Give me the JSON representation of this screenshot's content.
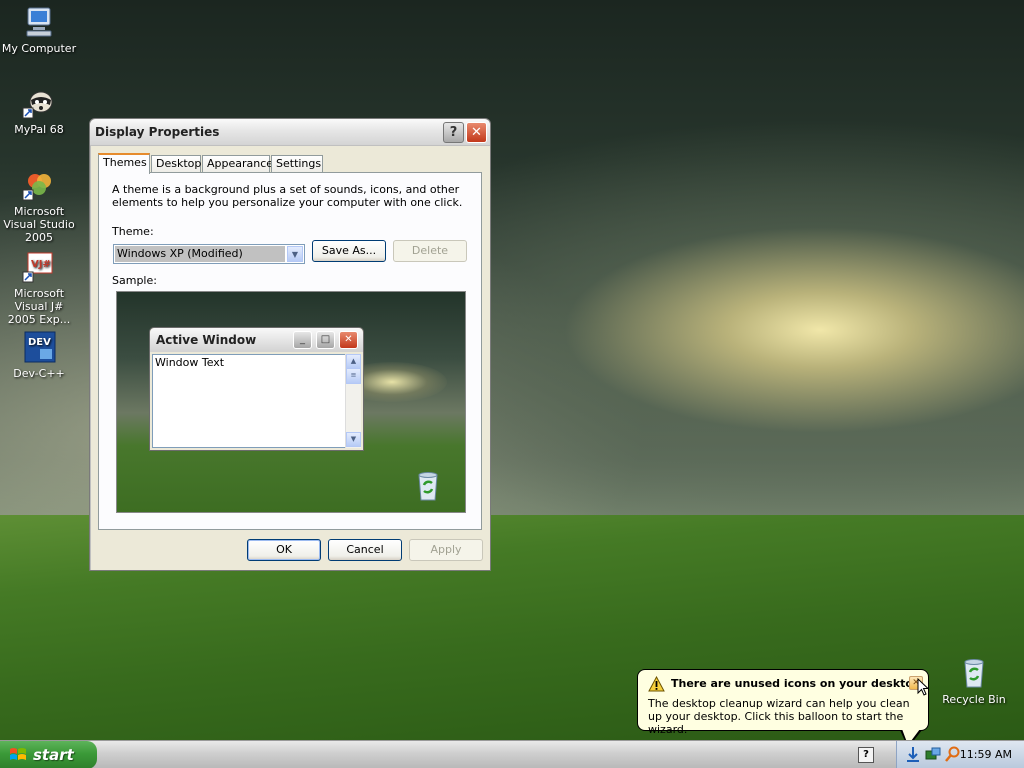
{
  "desktop": {
    "icons": [
      {
        "label": "My Computer"
      },
      {
        "label": "MyPal 68"
      },
      {
        "label": "Microsoft Visual Studio 2005"
      },
      {
        "label": "Microsoft Visual J# 2005 Exp..."
      },
      {
        "label": "Dev-C++"
      },
      {
        "label": "Recycle Bin"
      }
    ]
  },
  "dialog": {
    "title": "Display Properties",
    "tabs": [
      "Themes",
      "Desktop",
      "Appearance",
      "Settings"
    ],
    "active_tab": "Themes",
    "description": "A theme is a background plus a set of sounds, icons, and other elements to help you personalize your computer with one click.",
    "theme_label": "Theme:",
    "theme_value": "Windows XP (Modified)",
    "save_as_label": "Save As...",
    "delete_label": "Delete",
    "sample_label": "Sample:",
    "preview": {
      "window_title": "Active Window",
      "window_text": "Window Text"
    },
    "ok_label": "OK",
    "cancel_label": "Cancel",
    "apply_label": "Apply"
  },
  "balloon": {
    "title": "There are unused icons on your desktop",
    "body": "The desktop cleanup wizard can help you clean up your desktop. Click this balloon to start the wizard."
  },
  "taskbar": {
    "start_label": "start",
    "clock": "11:59 AM"
  },
  "colors": {
    "start_green": "#3b9a38",
    "balloon_bg": "#ffffe1",
    "tab_accent": "#e68b2c"
  }
}
